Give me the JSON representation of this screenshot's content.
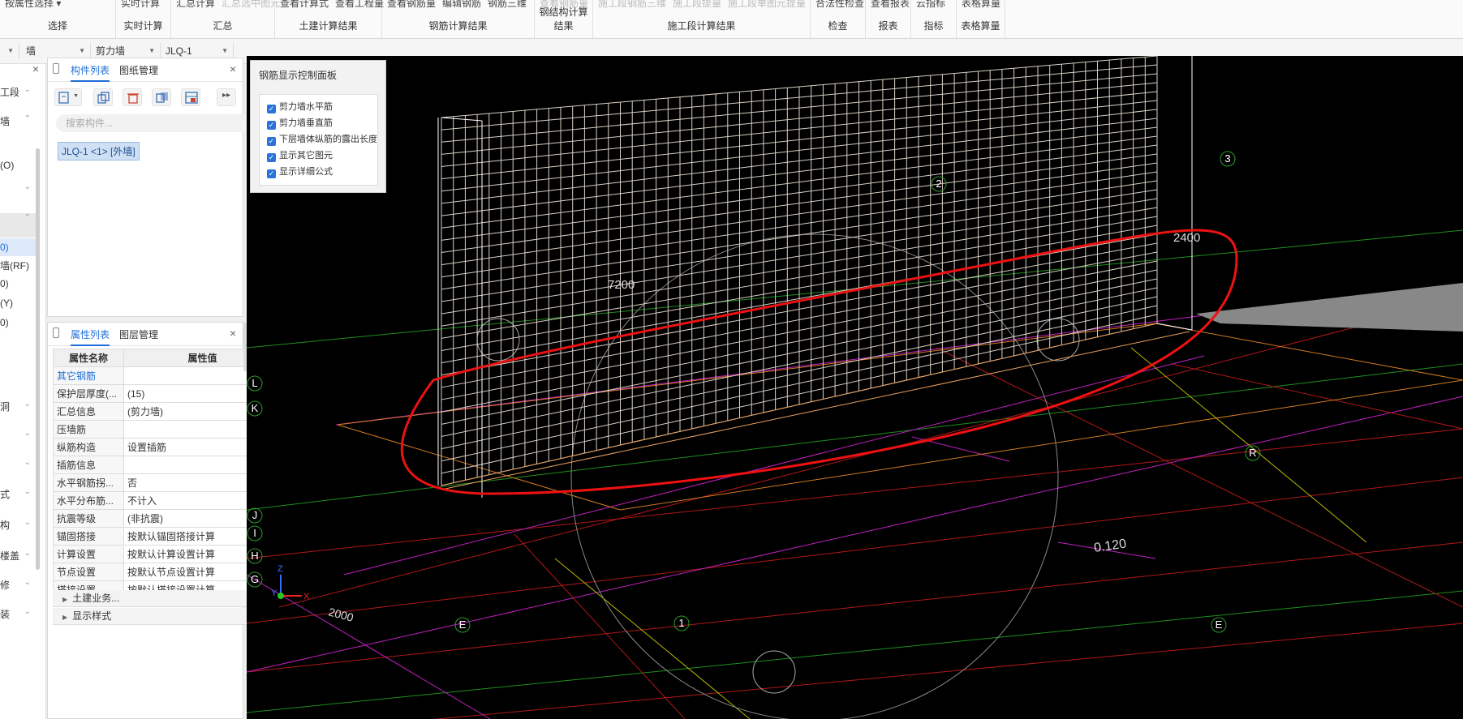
{
  "ribbon": {
    "groups": [
      {
        "label": "选择",
        "items": [
          "按属性选择 ▾"
        ]
      },
      {
        "label": "实时计算",
        "items": [
          "实时计算"
        ]
      },
      {
        "label": "汇总",
        "items": [
          "汇总计算",
          "汇总选中图元"
        ]
      },
      {
        "label": "土建计算结果",
        "items": [
          "查看计算式",
          "查看工程量"
        ]
      },
      {
        "label": "钢筋计算结果",
        "items": [
          "查看钢筋量",
          "编辑钢筋",
          "钢筋三维"
        ]
      },
      {
        "label": "钢结构计算结果",
        "items": [
          "查看钢筋量"
        ]
      },
      {
        "label": "施工段计算结果",
        "items": [
          "施工段钢筋三维",
          "施工段提量",
          "施工段单图元提量"
        ]
      },
      {
        "label": "检查",
        "items": [
          "合法性检查"
        ]
      },
      {
        "label": "报表",
        "items": [
          "查看报表"
        ]
      },
      {
        "label": "指标",
        "items": [
          "云指标"
        ]
      },
      {
        "label": "表格算量",
        "items": [
          "表格算量"
        ]
      }
    ]
  },
  "filter": {
    "category": "墙",
    "type": "剪力墙",
    "element": "JLQ-1"
  },
  "leftnav": {
    "items": [
      "工段",
      "墙",
      "(O)",
      "",
      "",
      "0)",
      "墙(RF)",
      "0)",
      "(Y)",
      "0)",
      "洞",
      "",
      "",
      "式",
      "构",
      "楼盖",
      "修",
      "装"
    ]
  },
  "component_panel": {
    "tabs": [
      "构件列表",
      "图纸管理"
    ],
    "search_placeholder": "搜索构件...",
    "selected_component": "JLQ-1 <1> [外墙]"
  },
  "property_panel": {
    "tabs": [
      "属性列表",
      "图层管理"
    ],
    "header_name": "属性名称",
    "header_value": "属性值",
    "rows": [
      {
        "name": "其它钢筋",
        "value": ""
      },
      {
        "name": "保护层厚度(...",
        "value": "(15)"
      },
      {
        "name": "汇总信息",
        "value": "(剪力墙)"
      },
      {
        "name": "压墙筋",
        "value": ""
      },
      {
        "name": "纵筋构造",
        "value": "设置插筋"
      },
      {
        "name": "插筋信息",
        "value": ""
      },
      {
        "name": "水平钢筋拐...",
        "value": "否"
      },
      {
        "name": "水平分布筋...",
        "value": "不计入"
      },
      {
        "name": "抗震等级",
        "value": "(非抗震)"
      },
      {
        "name": "锚固搭接",
        "value": "按默认锚固搭接计算"
      },
      {
        "name": "计算设置",
        "value": "按默认计算设置计算"
      },
      {
        "name": "节点设置",
        "value": "按默认节点设置计算"
      },
      {
        "name": "搭接设置",
        "value": "按默认搭接设置计算"
      }
    ],
    "expanders": [
      "土建业务...",
      "显示样式"
    ]
  },
  "control_panel": {
    "title": "钢筋显示控制面板",
    "options": [
      {
        "label": "剪力墙水平筋",
        "checked": true
      },
      {
        "label": "剪力墙垂直筋",
        "checked": true
      },
      {
        "label": "下层墙体纵筋的露出长度",
        "checked": true
      },
      {
        "label": "显示其它图元",
        "checked": true
      },
      {
        "label": "显示详细公式",
        "checked": true
      }
    ]
  },
  "viewport": {
    "dimensions": [
      "7200",
      "2400",
      "0.120",
      "2000"
    ],
    "axis_labels": [
      "L",
      "K",
      "J",
      "I",
      "H",
      "G",
      "3",
      "2",
      "R",
      "1",
      "E",
      "E"
    ],
    "gizmo": {
      "x": "X",
      "y": "Y",
      "z": "Z"
    }
  }
}
